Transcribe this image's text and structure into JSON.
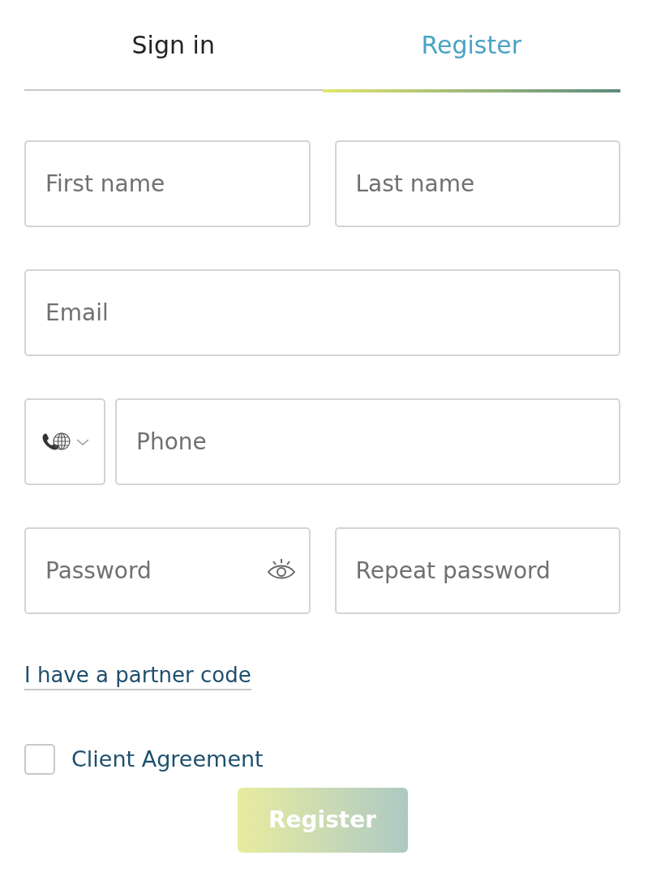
{
  "tabs": [
    {
      "label": "Sign in",
      "selected": false
    },
    {
      "label": "Register",
      "selected": true
    }
  ],
  "fields": {
    "first_name": {
      "placeholder": "First name"
    },
    "last_name": {
      "placeholder": "Last name"
    },
    "email": {
      "placeholder": "Email"
    },
    "phone": {
      "placeholder": "Phone"
    },
    "password": {
      "placeholder": "Password"
    },
    "repeat_password": {
      "placeholder": "Repeat password"
    }
  },
  "partner_link": "I have a partner code",
  "agreement": {
    "label": "Client Agreement",
    "checked": false
  },
  "submit": {
    "label": "Register",
    "disabled": true
  }
}
